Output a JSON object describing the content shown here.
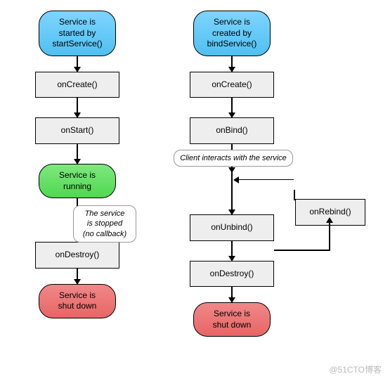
{
  "left": {
    "start": "Service is\nstarted by\nstartService()",
    "onCreate": "onCreate()",
    "onStart": "onStart()",
    "running": "Service is\nrunning",
    "stopLabel": "The service\nis stopped\n(no callback)",
    "onDestroy": "onDestroy()",
    "end": "Service is\nshut down"
  },
  "right": {
    "start": "Service is\ncreated by\nbindService()",
    "onCreate": "onCreate()",
    "onBind": "onBind()",
    "interactLabel": "Client interacts with the service",
    "onUnbind": "onUnbind()",
    "onDestroy": "onDestroy()",
    "end": "Service is\nshut down",
    "onRebind": "onRebind()"
  },
  "watermark": "@51CTO博客"
}
